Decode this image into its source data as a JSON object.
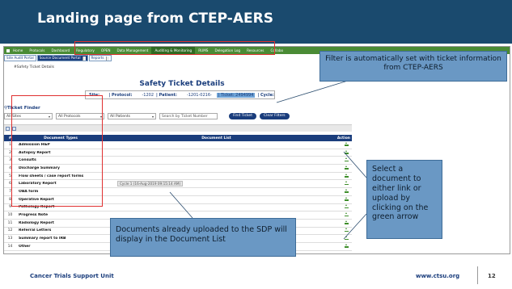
{
  "slide": {
    "title": "Landing page from CTEP-AERS",
    "footer_left": "Cancer Trials Support Unit",
    "footer_right": "www.ctsu.org",
    "page_number": "12"
  },
  "nav": {
    "items": [
      "Home",
      "Protocols",
      "Dashboard",
      "Regulatory",
      "OPEN",
      "Data Management",
      "Auditing & Monitoring",
      "RUMS",
      "Delegation Log",
      "Resources",
      "Collabo"
    ],
    "active_index": 6
  },
  "tabs": {
    "site_audit": "Site Audit Portal",
    "source_doc": "Source Document Portal",
    "reports": "Reports"
  },
  "breadcrumb": "#Safety Ticket Details",
  "panel": {
    "title": "Safety Ticket Details",
    "site_label": "Site:",
    "protocol_label": "| Protocol:",
    "protocol_value": "-1202",
    "patient_label": "| Patient:",
    "patient_value": "-1201-0216-",
    "ticket_label": "| Ticket: 2494994",
    "cycle_label": "| Cycle:"
  },
  "finder": {
    "label": "Ticket Finder",
    "sites": "All Sites",
    "protocols": "All Protocols",
    "patients": "All Patients",
    "search_placeholder": "Search by Ticket Number",
    "find_btn": "Find Ticket",
    "clear_btn": "Clear Filters"
  },
  "table": {
    "headers": {
      "num": "#",
      "doc": "Document Types",
      "list": "Document List",
      "action": "Action"
    },
    "rows": [
      {
        "num": "1",
        "doc": "Admission H&P",
        "list": ""
      },
      {
        "num": "2",
        "doc": "Autopsy Report",
        "list": ""
      },
      {
        "num": "3",
        "doc": "Consults",
        "list": ""
      },
      {
        "num": "4",
        "doc": "Discharge Summary",
        "list": ""
      },
      {
        "num": "5",
        "doc": "Flow sheets / case report forms",
        "list": ""
      },
      {
        "num": "6",
        "doc": "Laboratory Report",
        "list": "Cycle 1 (16-Aug-2019 09:15:14 AM)"
      },
      {
        "num": "7",
        "doc": "OBA form",
        "list": ""
      },
      {
        "num": "8",
        "doc": "Operative Report",
        "list": ""
      },
      {
        "num": "9",
        "doc": "Pathology Report",
        "list": ""
      },
      {
        "num": "10",
        "doc": "Progress Note",
        "list": ""
      },
      {
        "num": "11",
        "doc": "Radiology Report",
        "list": ""
      },
      {
        "num": "12",
        "doc": "Referral Letters",
        "list": ""
      },
      {
        "num": "13",
        "doc": "Summary report to IRB",
        "list": ""
      },
      {
        "num": "14",
        "doc": "Other",
        "list": ""
      }
    ]
  },
  "callouts": {
    "filter": "Filter is automatically set with ticket information from CTEP-AERS",
    "select": "Select a document to either link or upload by clicking on the green arrow",
    "docs": "Documents already uploaded to the SDP will display in the Document List"
  },
  "colors": {
    "title_bg": "#1a4a6e",
    "nav_bg": "#4a8b35",
    "brand_blue": "#1a3d7c",
    "callout_bg": "#6a98c4",
    "highlight_red": "#e03030",
    "action_green": "#3e8e2a"
  },
  "icons": {
    "action": "upload-arrow-icon",
    "finder": "magnifier-icon"
  }
}
